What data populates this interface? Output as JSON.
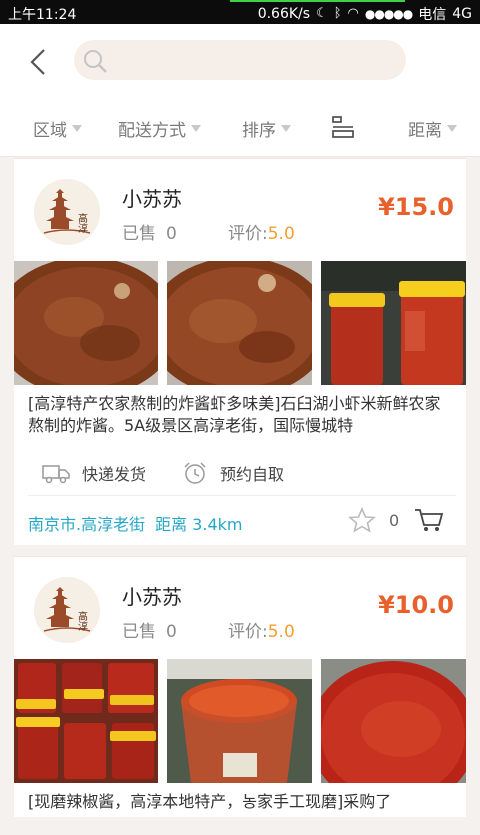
{
  "status_bar": {
    "time": "上午11:24",
    "speed": "0.66K/s",
    "signal_dots": "●●●●●",
    "carrier": "电信",
    "network": "4G"
  },
  "header": {
    "search_placeholder": ""
  },
  "filters": [
    {
      "label": "区域"
    },
    {
      "label": "配送方式"
    },
    {
      "label": "排序"
    },
    {
      "label": "距离"
    }
  ],
  "listings": [
    {
      "shop_name": "小苏苏",
      "sold_label": "已售",
      "sold_count": "0",
      "rating_label": "评价:",
      "rating_value": "5.0",
      "price": "¥15.0",
      "description": "[高淳特产农家熬制的炸酱虾多味美]石臼湖小虾米新鲜农家熬制的炸酱。5A级景区高淳老街，国际慢城特",
      "delivery": "快递发货",
      "pickup": "预约自取",
      "location": "南京市.高淳老街",
      "distance": "距离 3.4km",
      "fav_count": "0"
    },
    {
      "shop_name": "小苏苏",
      "sold_label": "已售",
      "sold_count": "0",
      "rating_label": "评价:",
      "rating_value": "5.0",
      "price": "¥10.0",
      "description": "[现磨辣椒酱，高淳本地特产，농家手工现磨]采购了",
      "delivery": "",
      "pickup": "",
      "location": "",
      "distance": "",
      "fav_count": ""
    }
  ],
  "logo_text": "高淳",
  "colors": {
    "accent_price": "#e8612c",
    "rating": "#f0a030",
    "location": "#27a7c7"
  }
}
